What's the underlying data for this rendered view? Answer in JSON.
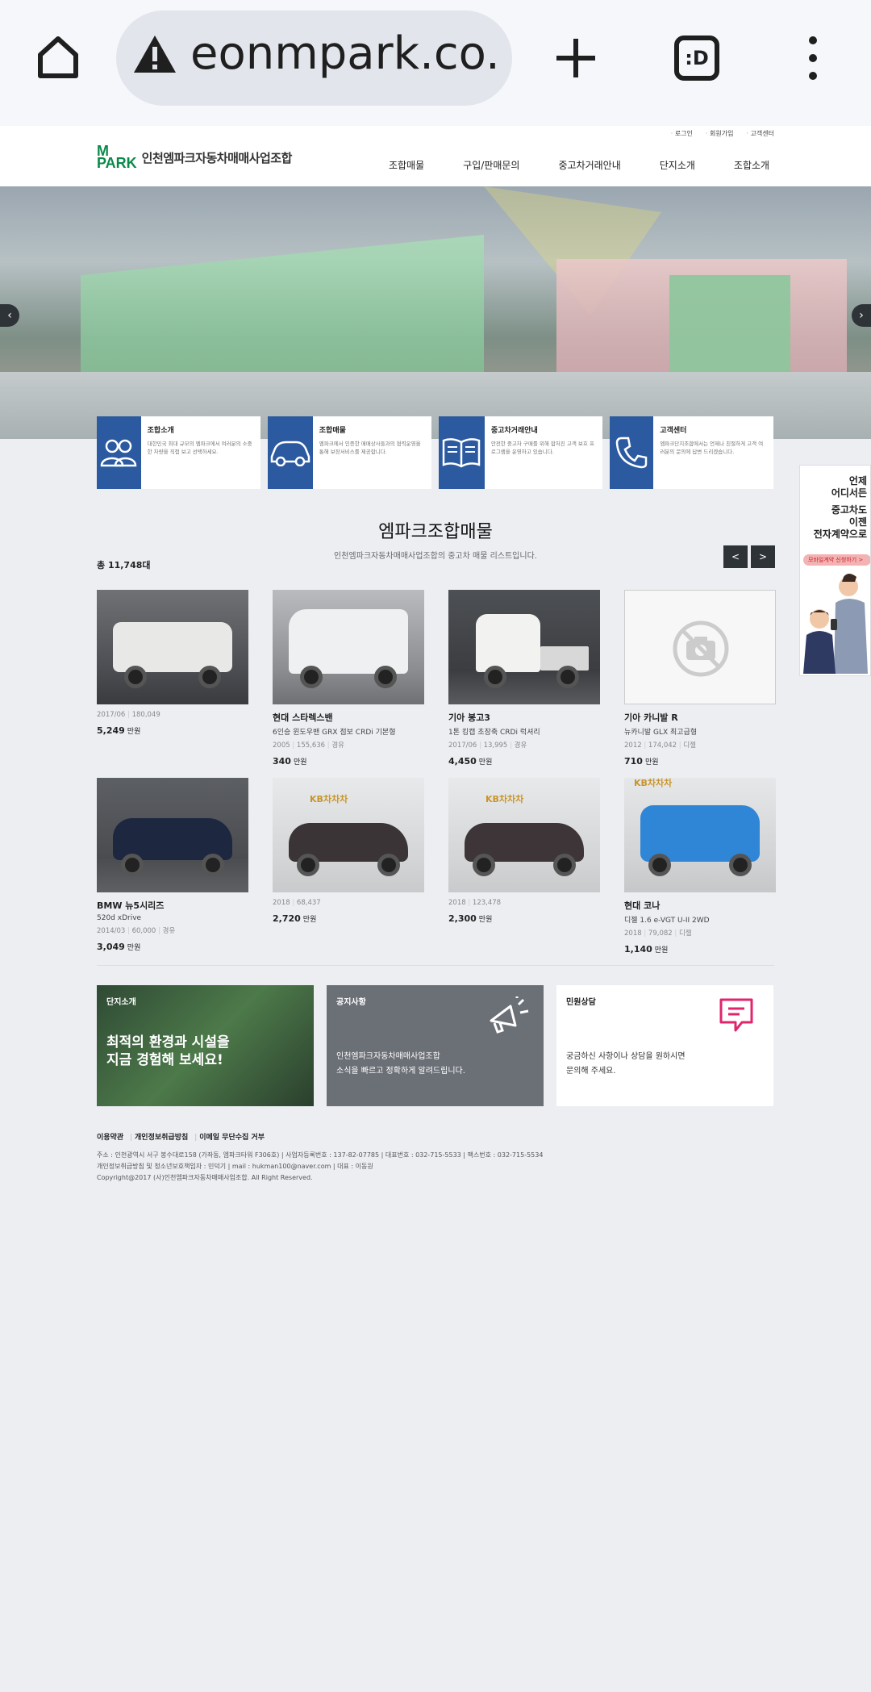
{
  "browser": {
    "url": "eonmpark.co.kr",
    "tabs_label": ":D"
  },
  "header": {
    "top_links": [
      "로그인",
      "회원가입",
      "고객센터"
    ],
    "logo_mark_top": "M",
    "logo_mark_bottom": "PARK",
    "logo_name": "인천엠파크자동차매매사업조합",
    "nav": [
      "조합매물",
      "구입/판매문의",
      "중고차거래안내",
      "단지소개",
      "조합소개"
    ]
  },
  "quick_cards": [
    {
      "title": "조합소개",
      "desc": "대한민국 최대 규모의 엠파크에서 여러분의 소중한 차량을 직접 보고 선택하세요.",
      "icon": "people-icon"
    },
    {
      "title": "조합매물",
      "desc": "엠파크에서 인증한 매매상사들과의 협력운영을 통해 보장서비스를 제공합니다.",
      "icon": "car-icon"
    },
    {
      "title": "중고차거래안내",
      "desc": "안전한 중고차 구매를 위해 합처진 고객 보호 프로그램을 운영하고 있습니다.",
      "icon": "book-icon"
    },
    {
      "title": "고객센터",
      "desc": "엠파크단지조합에서는 언제나 친절하게 고객 여러분의 문의에 답변 드리겠습니다.",
      "icon": "phone-icon"
    }
  ],
  "listing": {
    "title": "엠파크조합매물",
    "subtitle": "인천엠파크자동차매매사업조합의 중고차 매물 리스트입니다.",
    "total": "총 11,748대",
    "prev": "<",
    "next": ">",
    "price_unit": "만원",
    "items": [
      {
        "name": "",
        "sub": "",
        "specs": [
          "2017/06",
          "180,049"
        ],
        "price": "5,249",
        "photo": "white-suv"
      },
      {
        "name": "현대 스타렉스밴",
        "sub": "6인승 윈도우밴 GRX 점보 CRDi 기본형",
        "specs": [
          "2005",
          "155,636",
          "경유"
        ],
        "price": "340",
        "photo": "white-van"
      },
      {
        "name": "기아 봉고3",
        "sub": "1톤 킹캡 초장축 CRDi 럭셔리",
        "specs": [
          "2017/06",
          "13,995",
          "경유"
        ],
        "price": "4,450",
        "photo": "white-truck"
      },
      {
        "name": "기아 카니발 R",
        "sub": "뉴카니발 GLX 최고급형",
        "specs": [
          "2012",
          "174,042",
          "디젤"
        ],
        "price": "710",
        "photo": "none"
      },
      {
        "name": "BMW 뉴5시리즈",
        "sub": "520d xDrive",
        "specs": [
          "2014/03",
          "60,000",
          "경유"
        ],
        "price": "3,049",
        "photo": "navy-sedan"
      },
      {
        "name": "",
        "sub": "",
        "specs": [
          "2018",
          "68,437"
        ],
        "price": "2,720",
        "photo": "black-sedan-kb"
      },
      {
        "name": "",
        "sub": "",
        "specs": [
          "2018",
          "123,478"
        ],
        "price": "2,300",
        "photo": "black-sedan-kb"
      },
      {
        "name": "현대 코나",
        "sub": "디젤 1.6 e-VGT U-II 2WD",
        "specs": [
          "2018",
          "79,082",
          "디젤"
        ],
        "price": "1,140",
        "photo": "blue-suv"
      }
    ],
    "kb_label": "KB차차차"
  },
  "promo": {
    "box1": {
      "title": "단지소개",
      "line1": "최적의 환경과 시설을",
      "line2": "지금 경험해 보세요!"
    },
    "box2": {
      "title": "공지사항",
      "line1": "인천엠파크자동차매매사업조합",
      "line2": "소식을 빠르고 정확하게 알려드립니다."
    },
    "box3": {
      "title": "민원상담",
      "line1": "궁금하신 사항이나 상담을 원하시면",
      "line2": "문의해 주세요."
    }
  },
  "footer": {
    "links": [
      "이용약관",
      "개인정보취급방침",
      "이메일 무단수집 거부"
    ],
    "line1": "주소 : 인천광역시 서구 봉수대로158 (가좌동, 엠파크타워 F306호)  |  사업자등록번호 : 137-82-07785  |  대표번호 : 032-715-5533  |  팩스번호 : 032-715-5534",
    "line2": "개인정보취급방침 및 청소년보호책임자 : 민덕기  |  mail : hukman100@naver.com  |  대표 : 이동원",
    "line3": "Copyright@2017 (사)인천엠파크자동차매매사업조합. All Right Reserved."
  },
  "side_ad": {
    "line1": "언제",
    "line2": "어디서든",
    "line3": "중고차도",
    "line4": "이젠",
    "line5": "전자계약으로",
    "button": "모바일계약 신청하기 >"
  },
  "colors": {
    "brand_green": "#0a8a4a",
    "card_blue": "#2b5aa0",
    "dark_button": "#2e3338"
  }
}
